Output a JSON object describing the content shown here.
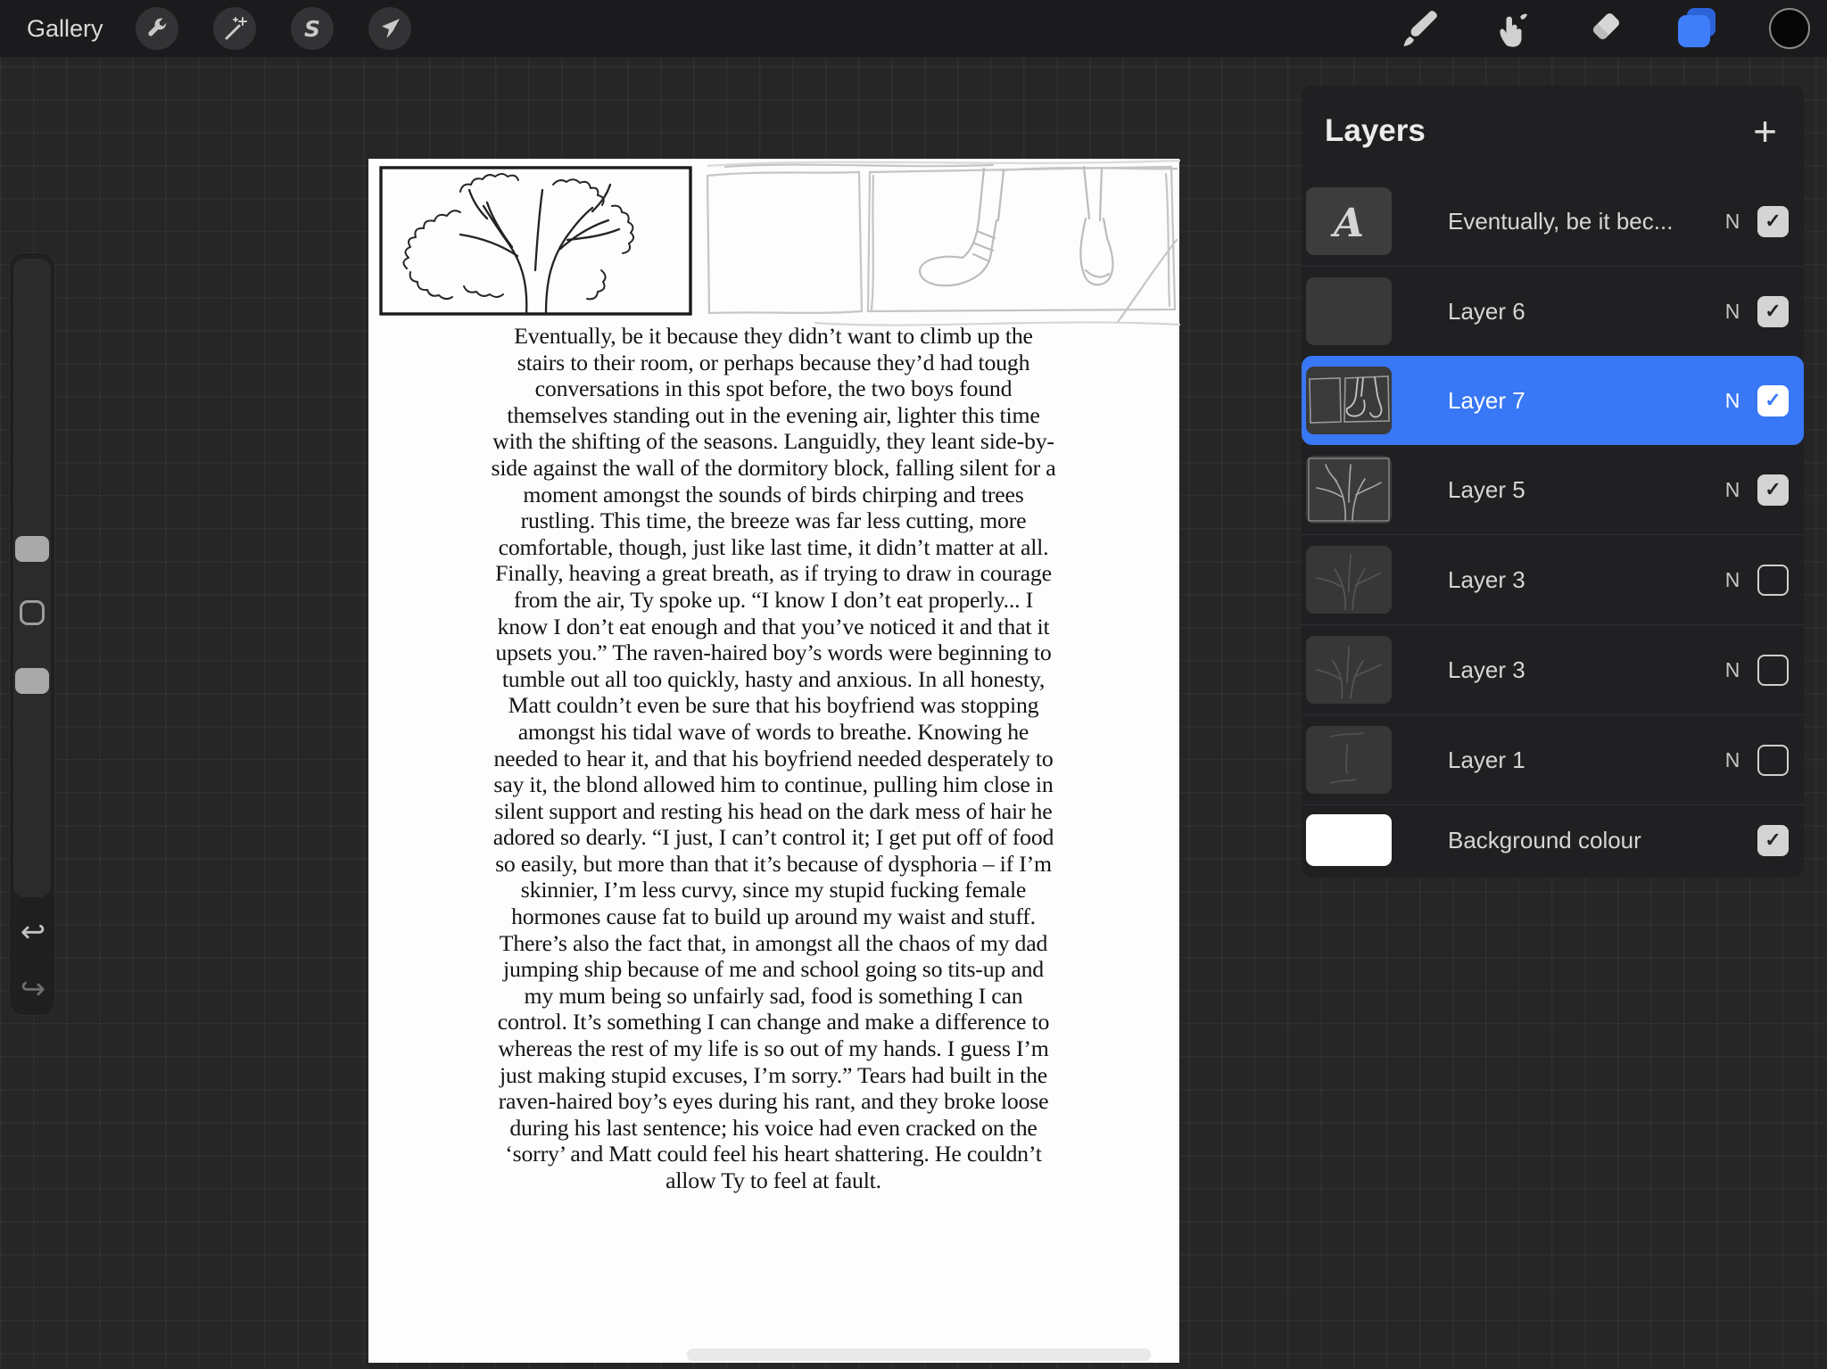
{
  "topbar": {
    "gallery_label": "Gallery",
    "left_tools": [
      "actions-wrench",
      "adjustments-wand",
      "selection-s",
      "transform-arrow"
    ],
    "right_tools": [
      "brush",
      "smudge",
      "eraser",
      "layers",
      "color"
    ],
    "selection_letter": "S"
  },
  "glyphs": {
    "plus": "+",
    "check": "✓",
    "undo": "↩",
    "redo": "↪"
  },
  "colors": {
    "accent_blue": "#3877F6",
    "panel_bg": "#202022",
    "canvas_bg": "#FDFDFD",
    "background_layer": "#FFFFFF"
  },
  "layers_panel": {
    "title": "Layers",
    "items": [
      {
        "name": "Eventually, be it bec...",
        "type": "text",
        "blend": "N",
        "visible": true,
        "selected": false
      },
      {
        "name": "Layer 6",
        "type": "empty",
        "blend": "N",
        "visible": true,
        "selected": false
      },
      {
        "name": "Layer 7",
        "type": "boots",
        "blend": "N",
        "visible": true,
        "selected": true
      },
      {
        "name": "Layer 5",
        "type": "tree",
        "blend": "N",
        "visible": true,
        "selected": false
      },
      {
        "name": "Layer 3",
        "type": "faint-tree",
        "blend": "N",
        "visible": false,
        "selected": false
      },
      {
        "name": "Layer 3",
        "type": "faint-tree",
        "blend": "N",
        "visible": false,
        "selected": false
      },
      {
        "name": "Layer 1",
        "type": "faint-marks",
        "blend": "N",
        "visible": false,
        "selected": false
      },
      {
        "name": "Background colour",
        "type": "background",
        "blend": "",
        "visible": true,
        "selected": false
      }
    ]
  },
  "canvas": {
    "story_text": "Eventually, be it because they didn’t want to climb up the stairs to their room, or perhaps because they’d had tough conversations in this spot before, the two boys found themselves standing out in the evening air, lighter this time with the shifting of the seasons. Languidly, they leant side-by-side against the wall of the dormitory block, falling silent for a moment amongst the sounds of birds chirping and trees rustling. This time, the breeze was far less cutting, more comfortable, though, just like last time, it didn’t matter at all. Finally, heaving a great breath, as if trying to draw in courage from the air, Ty spoke up.  “I know I don’t eat properly... I know I don’t eat enough and that you’ve noticed it and that it upsets you.” The raven-haired boy’s words were beginning to tumble out all too quickly, hasty and anxious. In all honesty, Matt couldn’t even be sure that his boyfriend was stopping amongst his tidal wave of words to breathe. Knowing he needed to hear it, and that his boyfriend needed desperately to say it, the blond allowed him to continue, pulling him close in silent support and resting his head on the dark mess of hair he adored so dearly. “I just, I can’t control it; I get put off of food so easily, but more than that it’s because of dysphoria – if I’m skinnier, I’m less curvy, since my stupid fucking female hormones cause fat to build up around my waist and stuff. There’s also the fact that, in amongst all the chaos of my dad jumping ship because of me and school going so tits-up and my mum being so unfairly sad, food is something I can control. It’s something I can change and make a difference to whereas the rest of my life is so out of my hands. I guess I’m just making stupid excuses, I’m sorry.” Tears had built in the raven-haired boy’s eyes during his rant, and they broke loose during his last sentence; his voice had even cracked on the ‘sorry’ and Matt could feel his heart shattering. He couldn’t allow Ty to feel at fault."
  }
}
